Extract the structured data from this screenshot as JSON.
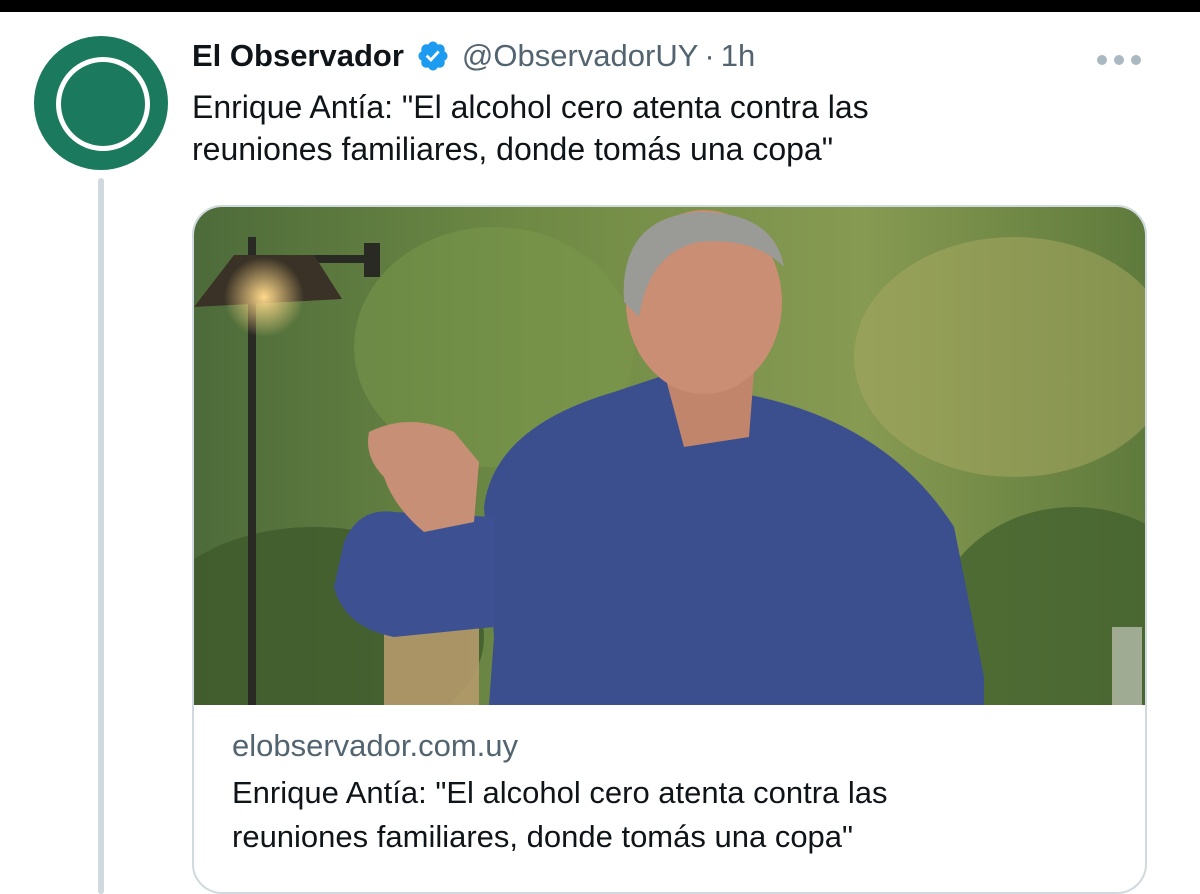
{
  "tweet": {
    "author": {
      "name": "El Observador",
      "handle": "@ObservadorUY",
      "separator": "·",
      "time": "1h",
      "verified": true
    },
    "text_line1": "Enrique Antía: \"El alcohol cero atenta contra las",
    "text_line2": "reuniones familiares, donde tomás una copa\"",
    "card": {
      "domain": "elobservador.com.uy",
      "title_line1": "Enrique Antía: \"El alcohol cero atenta contra las",
      "title_line2": "reuniones familiares, donde tomás una copa\""
    }
  },
  "icons": {
    "avatar": "el-observador-logo",
    "verified": "verified-badge-icon",
    "more": "more-options-icon"
  },
  "colors": {
    "brand_green": "#1b7a5e",
    "verified_blue": "#1d9bf0",
    "secondary_text": "#536471",
    "primary_text": "#0f1419",
    "border": "#cfd9de"
  }
}
